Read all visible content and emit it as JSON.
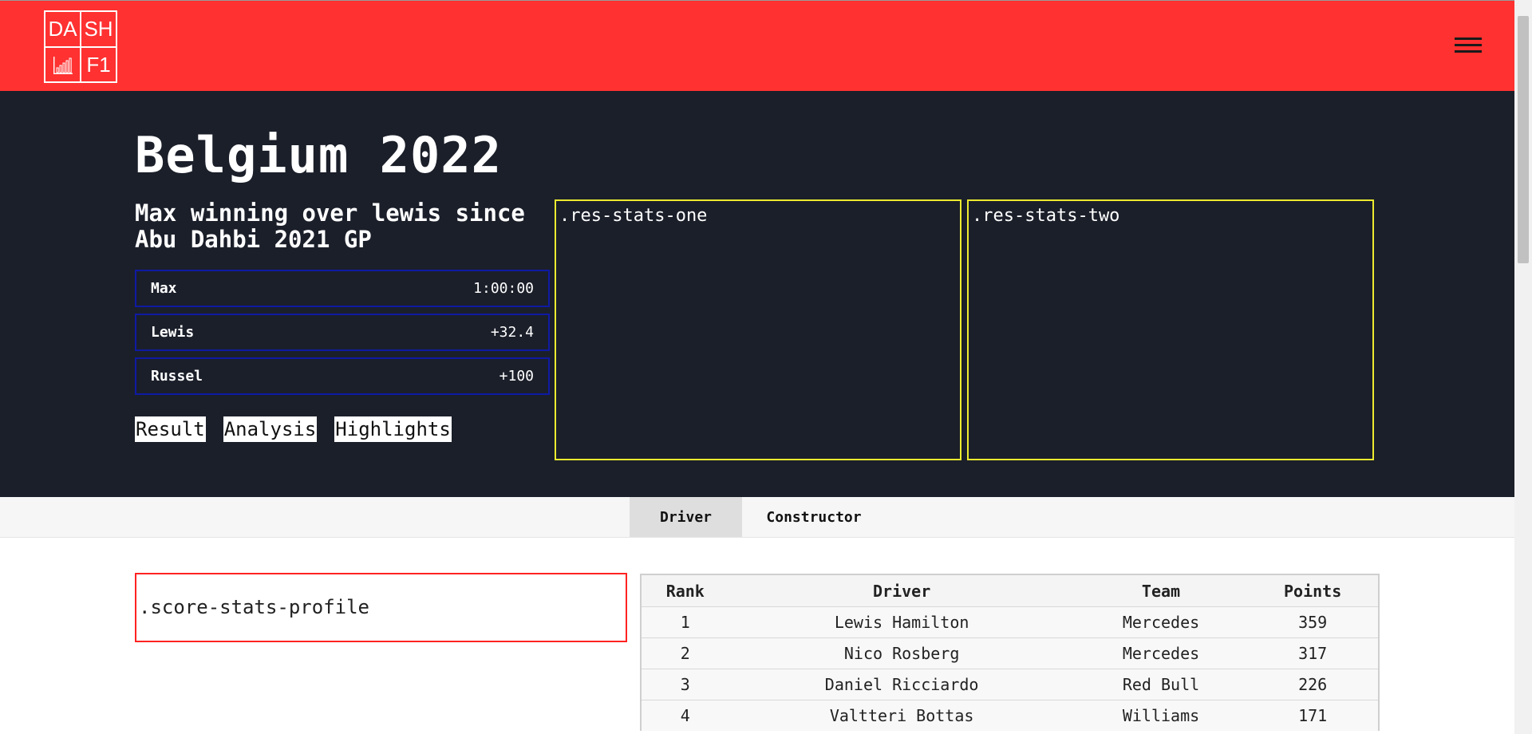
{
  "header": {
    "logo": {
      "top_left": "DA",
      "top_right": "SH",
      "bottom_left_icon": "bar-chart-icon",
      "bottom_right": "F1"
    },
    "menu_icon": "hamburger-icon"
  },
  "hero": {
    "title": "Belgium 2022",
    "subtitle": "Max winning over lewis since Abu Dahbi 2021 GP",
    "results": [
      {
        "name": "Max",
        "time": "1:00:00"
      },
      {
        "name": "Lewis",
        "time": "+32.4"
      },
      {
        "name": "Russel",
        "time": "+100"
      }
    ],
    "buttons": [
      "Result",
      "Analysis",
      "Highlights"
    ],
    "stats_one_label": ".res-stats-one",
    "stats_two_label": ".res-stats-two"
  },
  "tabs": [
    "Driver",
    "Constructor"
  ],
  "active_tab": "Driver",
  "profile_label": ".score-stats-profile",
  "standings": {
    "columns": [
      "Rank",
      "Driver",
      "Team",
      "Points"
    ],
    "rows": [
      [
        "1",
        "Lewis Hamilton",
        "Mercedes",
        "359"
      ],
      [
        "2",
        "Nico Rosberg",
        "Mercedes",
        "317"
      ],
      [
        "3",
        "Daniel Ricciardo",
        "Red Bull",
        "226"
      ],
      [
        "4",
        "Valtteri Bottas",
        "Williams",
        "171"
      ]
    ]
  },
  "colors": {
    "header_red": "#ff3131",
    "hero_dark": "#1b1f2a",
    "result_border_blue": "#0e1aa3",
    "stats_border_yellow": "#ecea2f",
    "profile_border_red": "#ff2222"
  }
}
